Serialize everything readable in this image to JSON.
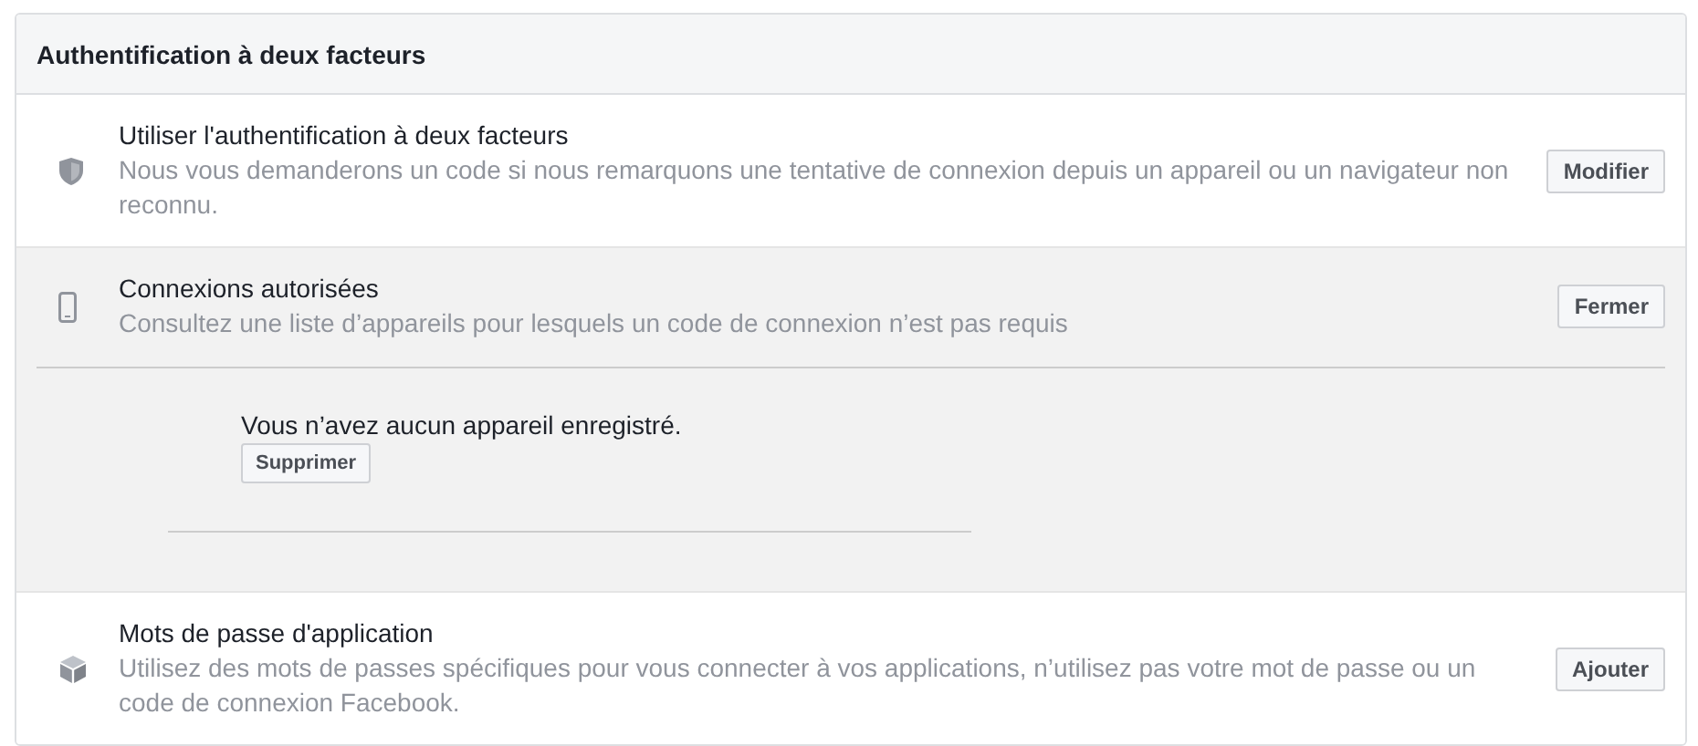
{
  "panel": {
    "title": "Authentification à deux facteurs"
  },
  "sections": [
    {
      "title": "Utiliser l'authentification à deux facteurs",
      "description": "Nous vous demanderons un code si nous remarquons une tentative de connexion depuis un appareil ou un navigateur non reconnu.",
      "button": "Modifier",
      "expanded": false
    },
    {
      "title": "Connexions autorisées",
      "description": "Consultez une liste d’appareils pour lesquels un code de connexion n’est pas requis",
      "button": "Fermer",
      "expanded": true,
      "detail": {
        "message": "Vous n’avez aucun appareil enregistré.",
        "button": "Supprimer"
      }
    },
    {
      "title": "Mots de passe d'application",
      "description": "Utilisez des mots de passes spécifiques pour vous connecter à vos applications, n’utilisez pas votre mot de passe ou un code de connexion Facebook.",
      "button": "Ajouter",
      "expanded": false
    }
  ]
}
